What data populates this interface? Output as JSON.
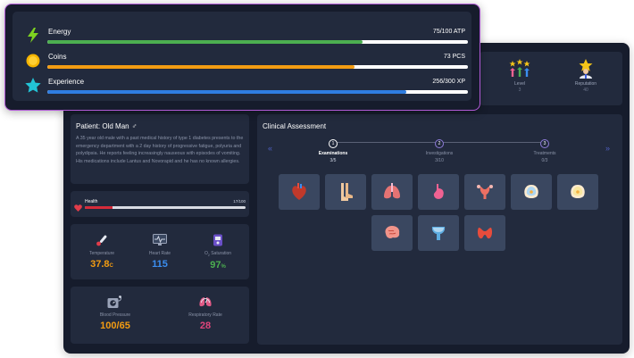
{
  "resources": {
    "energy": {
      "label": "Energy",
      "value": "75/100 ATP",
      "fraction": 0.75,
      "color": "#4caf50"
    },
    "coins": {
      "label": "Coins",
      "value": "73 PCS",
      "fraction": 0.73,
      "color": "#f39c12"
    },
    "experience": {
      "label": "Experience",
      "value": "256/300 XP",
      "fraction": 0.853,
      "color": "#2f7de1"
    }
  },
  "stats": {
    "level": {
      "label": "Level",
      "value": "3"
    },
    "reputation": {
      "label": "Reputation",
      "value": "40"
    }
  },
  "patient": {
    "title": "Patient: Old Man",
    "gender_symbol": "♂",
    "description": "A 35 year old male with a past medical history of type 1 diabetes presents to the emergency department with a 2 day history of progressive fatigue, polyuria and polydipsia. He reports feeling increasingly nauseous with episodes of vomiting. His medications include Lantus and Novorapid and he has no known allergies."
  },
  "health": {
    "label": "Health",
    "value": "17/100",
    "fraction": 0.17,
    "color": "#d62b3a"
  },
  "vitals": {
    "temperature": {
      "label": "Temperature",
      "value": "37.8",
      "unit": "C",
      "color": "#f39c12"
    },
    "heart_rate": {
      "label": "Heart Rate",
      "value": "115",
      "color": "#3b8ef0"
    },
    "o2": {
      "label_prefix": "O",
      "label_sub": "2",
      "label_suffix": " Saturation",
      "value": "97",
      "unit": "%",
      "color": "#4caf50"
    },
    "blood_pressure": {
      "label": "Blood Pressure",
      "value": "100/65",
      "color": "#f39c12"
    },
    "respiratory_rate": {
      "label": "Respiratory Rate",
      "value": "28",
      "color": "#e0457b"
    }
  },
  "clinical": {
    "title": "Clinical Assessment",
    "nav_prev": "«",
    "nav_next": "»",
    "steps": [
      {
        "number": "1",
        "name": "Examinations",
        "count": "3/5",
        "active": true
      },
      {
        "number": "2",
        "name": "Investigations",
        "count": "3/10",
        "active": false
      },
      {
        "number": "3",
        "name": "Treatments",
        "count": "0/3",
        "active": false
      }
    ],
    "organs": [
      "heart-icon",
      "legs-icon",
      "lungs-icon",
      "stomach-icon",
      "uterus-icon",
      "breast-left-icon",
      "breast-right-icon",
      "brain-icon",
      "bladder-icon",
      "thyroid-icon"
    ]
  }
}
